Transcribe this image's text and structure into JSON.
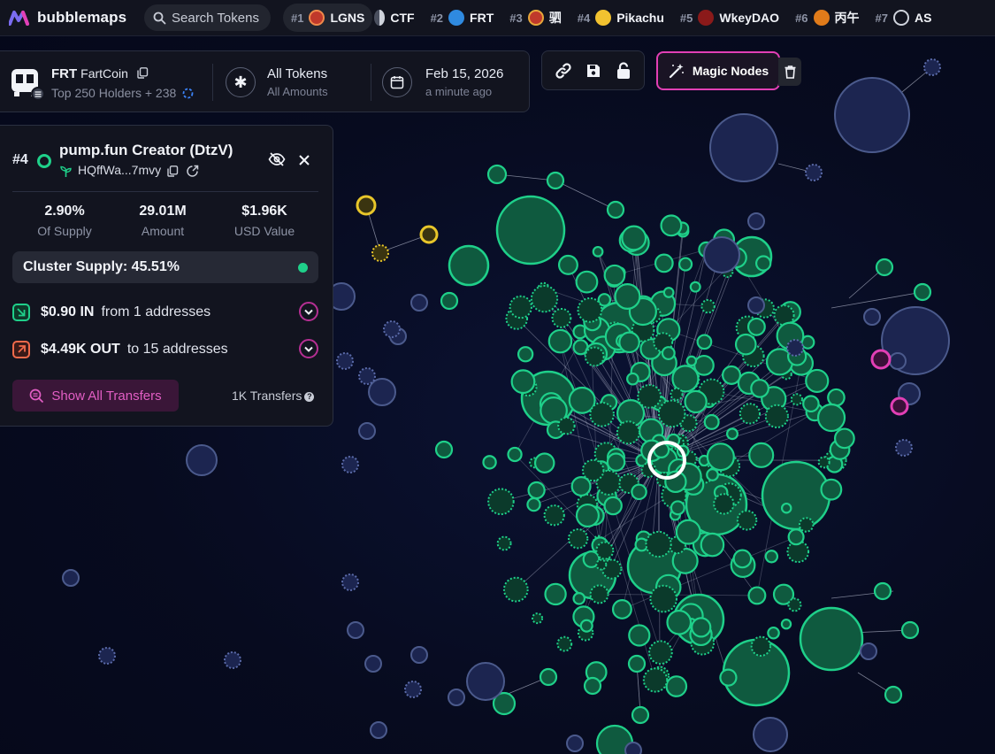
{
  "brand": {
    "name": "bubblemaps"
  },
  "search": {
    "label": "Search Tokens"
  },
  "trending": [
    {
      "rank": "#1",
      "name": "LGNS",
      "icon": "lgns-icon",
      "color": "#c0392b"
    },
    {
      "rank": "",
      "name": "CTF",
      "icon": "ctf-icon",
      "color": "#cfd3dc"
    },
    {
      "rank": "#2",
      "name": "FRT",
      "icon": "frt-icon",
      "color": "#2f8ae0"
    },
    {
      "rank": "#3",
      "name": "驷",
      "icon": "horse-icon",
      "color": "#c0392b"
    },
    {
      "rank": "#4",
      "name": "Pikachu",
      "icon": "pikachu-icon",
      "color": "#f2c230"
    },
    {
      "rank": "#5",
      "name": "WkeyDAO",
      "icon": "wkeydao-icon",
      "color": "#8b1a1a"
    },
    {
      "rank": "#6",
      "name": "丙午",
      "icon": "bingwu-icon",
      "color": "#e07b1a"
    },
    {
      "rank": "#7",
      "name": "AS",
      "icon": "as-icon",
      "color": "#cfd3dc"
    }
  ],
  "token": {
    "symbol": "FRT",
    "name": "FartCoin",
    "holders": "Top 250 Holders + 238",
    "filter_title": "All Tokens",
    "filter_sub": "All Amounts",
    "date": "Feb 15, 2026",
    "updated": "a minute ago"
  },
  "toolbar": {
    "magic_label": "Magic Nodes"
  },
  "holder": {
    "rank": "#4",
    "name": "pump.fun Creator (DtzV)",
    "address": "HQffWa...7mvy",
    "stats": [
      {
        "value": "2.90%",
        "label": "Of Supply"
      },
      {
        "value": "29.01M",
        "label": "Amount"
      },
      {
        "value": "$1.96K",
        "label": "USD Value"
      }
    ],
    "cluster_supply": "Cluster Supply: 45.51%",
    "in_amount": "$0.90 IN",
    "in_text": "from 1 addresses",
    "out_amount": "$4.49K OUT",
    "out_text": "to 15 addresses",
    "show_transfers": "Show All Transfers",
    "transfers_count": "1K Transfers"
  },
  "colors": {
    "accent_pink": "#e23fb5",
    "cluster_green": "#1fd08a",
    "isolated_blue": "#2a3560",
    "highlight_yellow": "#e8c62a"
  }
}
